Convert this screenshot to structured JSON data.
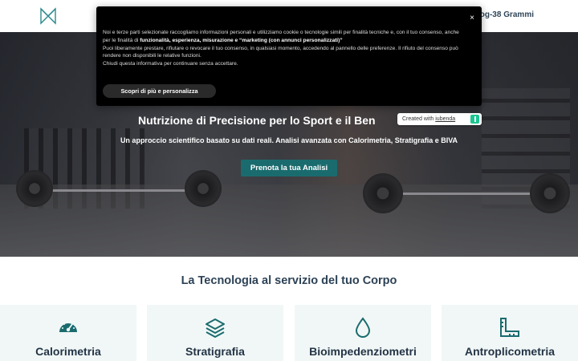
{
  "header": {
    "logo_icon": "brand-logo-icon",
    "nav_blog": "Blog-38 Grammi"
  },
  "cookie_banner": {
    "text_1": "Noi e terze parti selezionate raccogliamo informazioni personali e utilizziamo cookie o tecnologie simili per finalità tecniche e, con il tuo consenso, anche per le finalità di ",
    "text_bold": "funzionalità, esperienza, misurazione e “marketing (con annunci personalizzati)”",
    "text_2": "Puoi liberamente prestare, rifiutare o revocare il tuo consenso, in qualsiasi momento, accedendo al pannello delle preferenze. Il rifiuto del consenso può rendere non disponibili le relative funzioni.",
    "text_3": "Chiudi questa informativa per continuare senza accettare.",
    "close_symbol": "×",
    "button_label": "Scopri di più e personalizza"
  },
  "hero": {
    "title": "Nutrizione di Precisione per lo Sport e il Ben",
    "subtitle": "Un approccio scientifico basato su dati reali. Analisi avanzata con Calorimetria, Stratigrafia e BIVA",
    "cta_label": "Prenota la tua Analisi"
  },
  "iubenda": {
    "prefix": "Created with ",
    "link": "iubenda"
  },
  "section": {
    "title": "La Tecnologia al servizio del tuo Corpo"
  },
  "cards": [
    {
      "label": "Calorimetria",
      "icon": "gauge-icon"
    },
    {
      "label": "Stratigrafia",
      "icon": "layers-icon"
    },
    {
      "label": "Bioimpedenziometri",
      "icon": "droplet-icon"
    },
    {
      "label": "Antroplicometria",
      "icon": "ruler-icon"
    }
  ],
  "colors": {
    "accent": "#1a6b6e",
    "heading": "#2d4256",
    "card_bg": "#f1f7f6"
  }
}
